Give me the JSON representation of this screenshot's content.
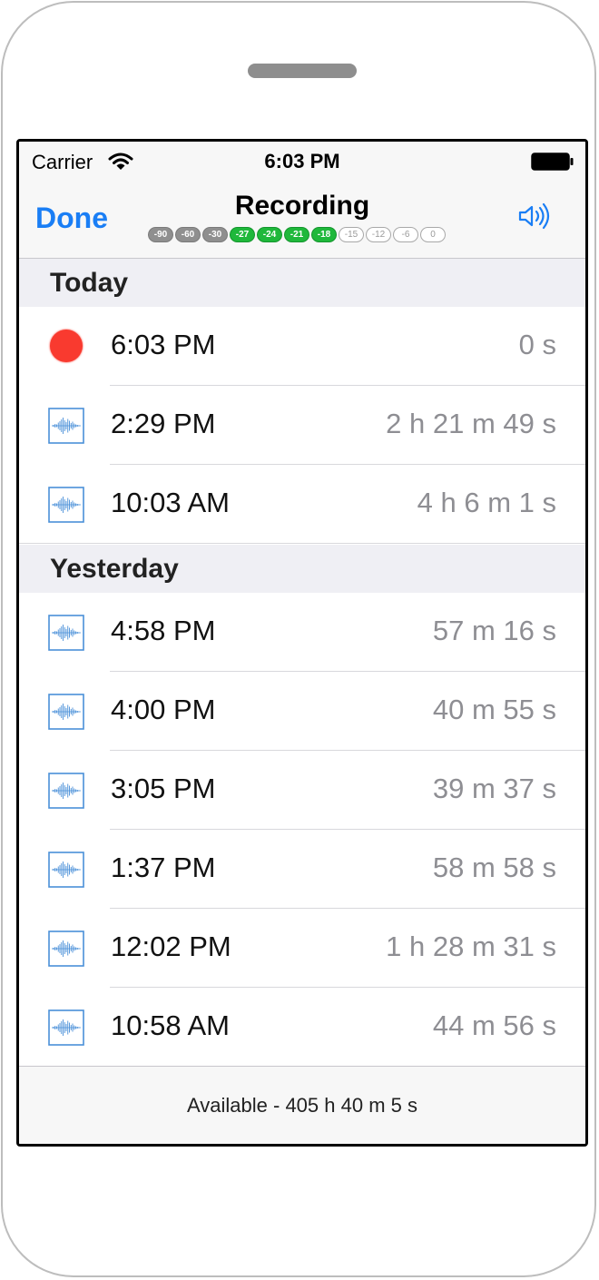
{
  "status_bar": {
    "carrier": "Carrier",
    "time": "6:03 PM"
  },
  "nav": {
    "done_label": "Done",
    "title": "Recording",
    "level_meter": [
      {
        "label": "-90",
        "state": "gray"
      },
      {
        "label": "-60",
        "state": "gray"
      },
      {
        "label": "-30",
        "state": "gray"
      },
      {
        "label": "-27",
        "state": "green"
      },
      {
        "label": "-24",
        "state": "green"
      },
      {
        "label": "-21",
        "state": "green"
      },
      {
        "label": "-18",
        "state": "green"
      },
      {
        "label": "-15",
        "state": "empty"
      },
      {
        "label": "-12",
        "state": "empty"
      },
      {
        "label": "-6",
        "state": "empty"
      },
      {
        "label": "0",
        "state": "empty"
      }
    ]
  },
  "sections": [
    {
      "title": "Today",
      "rows": [
        {
          "time": "6:03 PM",
          "duration": "0 s",
          "icon": "recording-dot"
        },
        {
          "time": "2:29 PM",
          "duration": "2 h 21 m 49 s",
          "icon": "waveform-icon"
        },
        {
          "time": "10:03 AM",
          "duration": "4 h 6 m 1 s",
          "icon": "waveform-icon"
        }
      ]
    },
    {
      "title": "Yesterday",
      "rows": [
        {
          "time": "4:58 PM",
          "duration": "57 m 16 s",
          "icon": "waveform-icon"
        },
        {
          "time": "4:00 PM",
          "duration": "40 m 55 s",
          "icon": "waveform-icon"
        },
        {
          "time": "3:05 PM",
          "duration": "39 m 37 s",
          "icon": "waveform-icon"
        },
        {
          "time": "1:37 PM",
          "duration": "58 m 58 s",
          "icon": "waveform-icon"
        },
        {
          "time": "12:02 PM",
          "duration": "1 h 28 m 31 s",
          "icon": "waveform-icon"
        },
        {
          "time": "10:58 AM",
          "duration": "44 m 56 s",
          "icon": "waveform-icon"
        }
      ]
    }
  ],
  "footer": {
    "available": "Available - 405 h 40 m 5 s"
  },
  "colors": {
    "accent": "#1a7ef5",
    "recording": "#f93a2f",
    "meter_active": "#1fb83b",
    "meter_inactive": "#8f8f8f"
  }
}
